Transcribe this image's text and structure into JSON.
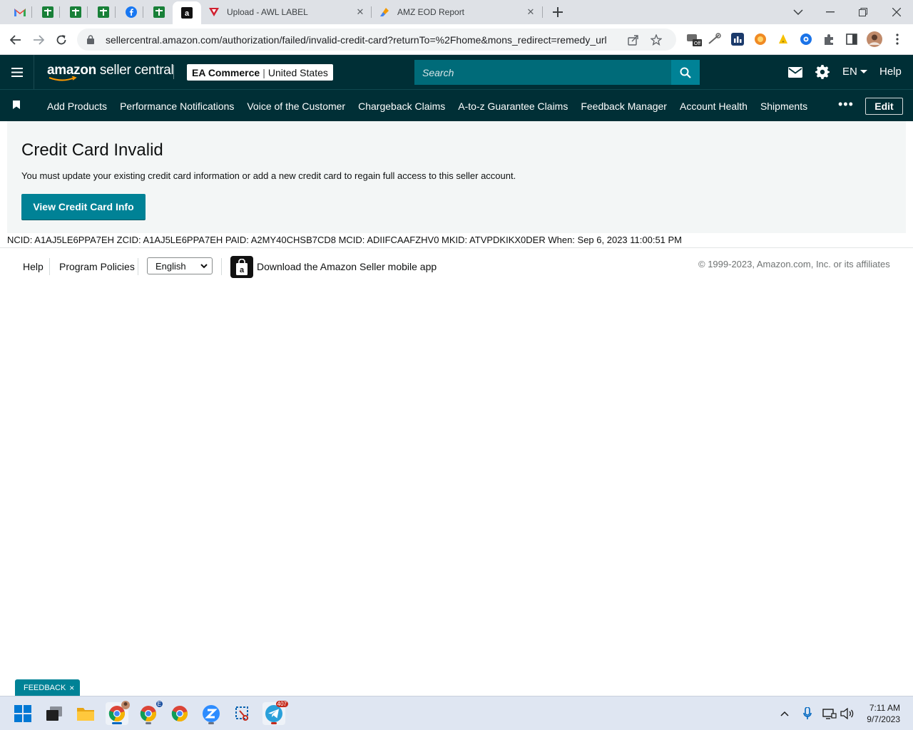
{
  "browser": {
    "tabs": [
      {
        "title": "Upload - AWL LABEL"
      },
      {
        "title": "AMZ EOD Report"
      }
    ],
    "url": "sellercentral.amazon.com/authorization/failed/invalid-credit-card?returnTo=%2Fhome&mons_redirect=remedy_url",
    "ext_badge": "Off"
  },
  "header": {
    "logo_brand": "amazon",
    "logo_product": " seller central",
    "account_name": "EA Commerce",
    "account_sep": "|",
    "marketplace": "United States",
    "search_placeholder": "Search",
    "language": "EN",
    "help": "Help"
  },
  "nav": {
    "items": [
      "Add Products",
      "Performance Notifications",
      "Voice of the Customer",
      "Chargeback Claims",
      "A-to-z Guarantee Claims",
      "Feedback Manager",
      "Account Health",
      "Shipments"
    ],
    "more": "•••",
    "edit": "Edit"
  },
  "main": {
    "title": "Credit Card Invalid",
    "message": "You must update your existing credit card information or add a new credit card to regain full access to this seller account.",
    "button": "View Credit Card Info"
  },
  "debug_line": "NCID: A1AJ5LE6PPA7EH ZCID: A1AJ5LE6PPA7EH PAID: A2MY40CHSB7CD8 MCID: ADIIFCAAFZHV0 MKID: ATVPDKIKX0DER When: Sep 6, 2023 11:00:51 PM",
  "footer": {
    "help": "Help",
    "policies": "Program Policies",
    "language": "English",
    "app": "Download the Amazon Seller mobile app",
    "copyright": "© 1999-2023, Amazon.com, Inc. or its affiliates"
  },
  "feedback": {
    "label": "FEEDBACK",
    "close": "×"
  },
  "taskbar": {
    "mail_badge": "407",
    "chrome_badge": "E",
    "time": "7:11 AM",
    "date": "9/7/2023"
  },
  "colors": {
    "header_bg": "#002f36",
    "accent": "#008296",
    "search_bg": "#006b79",
    "content_bg": "#f3f6f6"
  }
}
